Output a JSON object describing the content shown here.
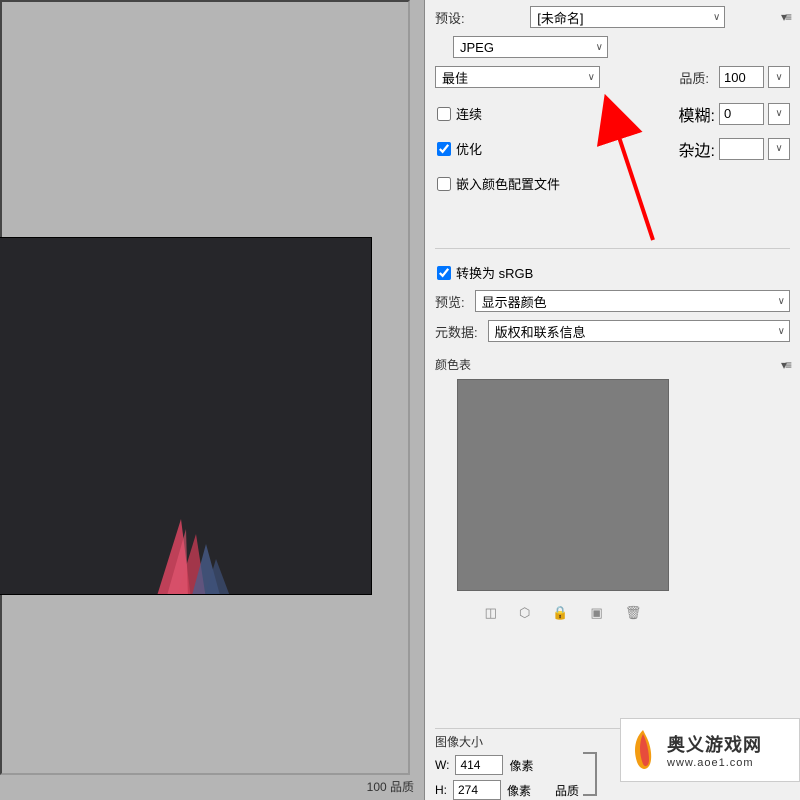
{
  "preset": {
    "label": "预设:",
    "value": "[未命名]"
  },
  "format": {
    "value": "JPEG"
  },
  "quality_preset": {
    "value": "最佳"
  },
  "quality": {
    "label": "品质:",
    "value": "100"
  },
  "progressive": {
    "label": "连续",
    "checked": false
  },
  "blur": {
    "label": "模糊:",
    "value": "0"
  },
  "optimized": {
    "label": "优化",
    "checked": true
  },
  "matte": {
    "label": "杂边:"
  },
  "embed_profile": {
    "label": "嵌入颜色配置文件",
    "checked": false
  },
  "convert_srgb": {
    "label": "转换为 sRGB",
    "checked": true
  },
  "preview": {
    "label": "预览:",
    "value": "显示器颜色"
  },
  "metadata": {
    "label": "元数据:",
    "value": "版权和联系信息"
  },
  "color_table": {
    "label": "颜色表"
  },
  "image_size": {
    "label": "图像大小",
    "w_label": "W:",
    "w_value": "414",
    "h_label": "H:",
    "h_value": "274",
    "unit": "像素",
    "quality_label": "品质"
  },
  "status": {
    "text": "100 品质"
  },
  "watermark": {
    "cn": "奥义游戏网",
    "url": "www.aoe1.com"
  }
}
